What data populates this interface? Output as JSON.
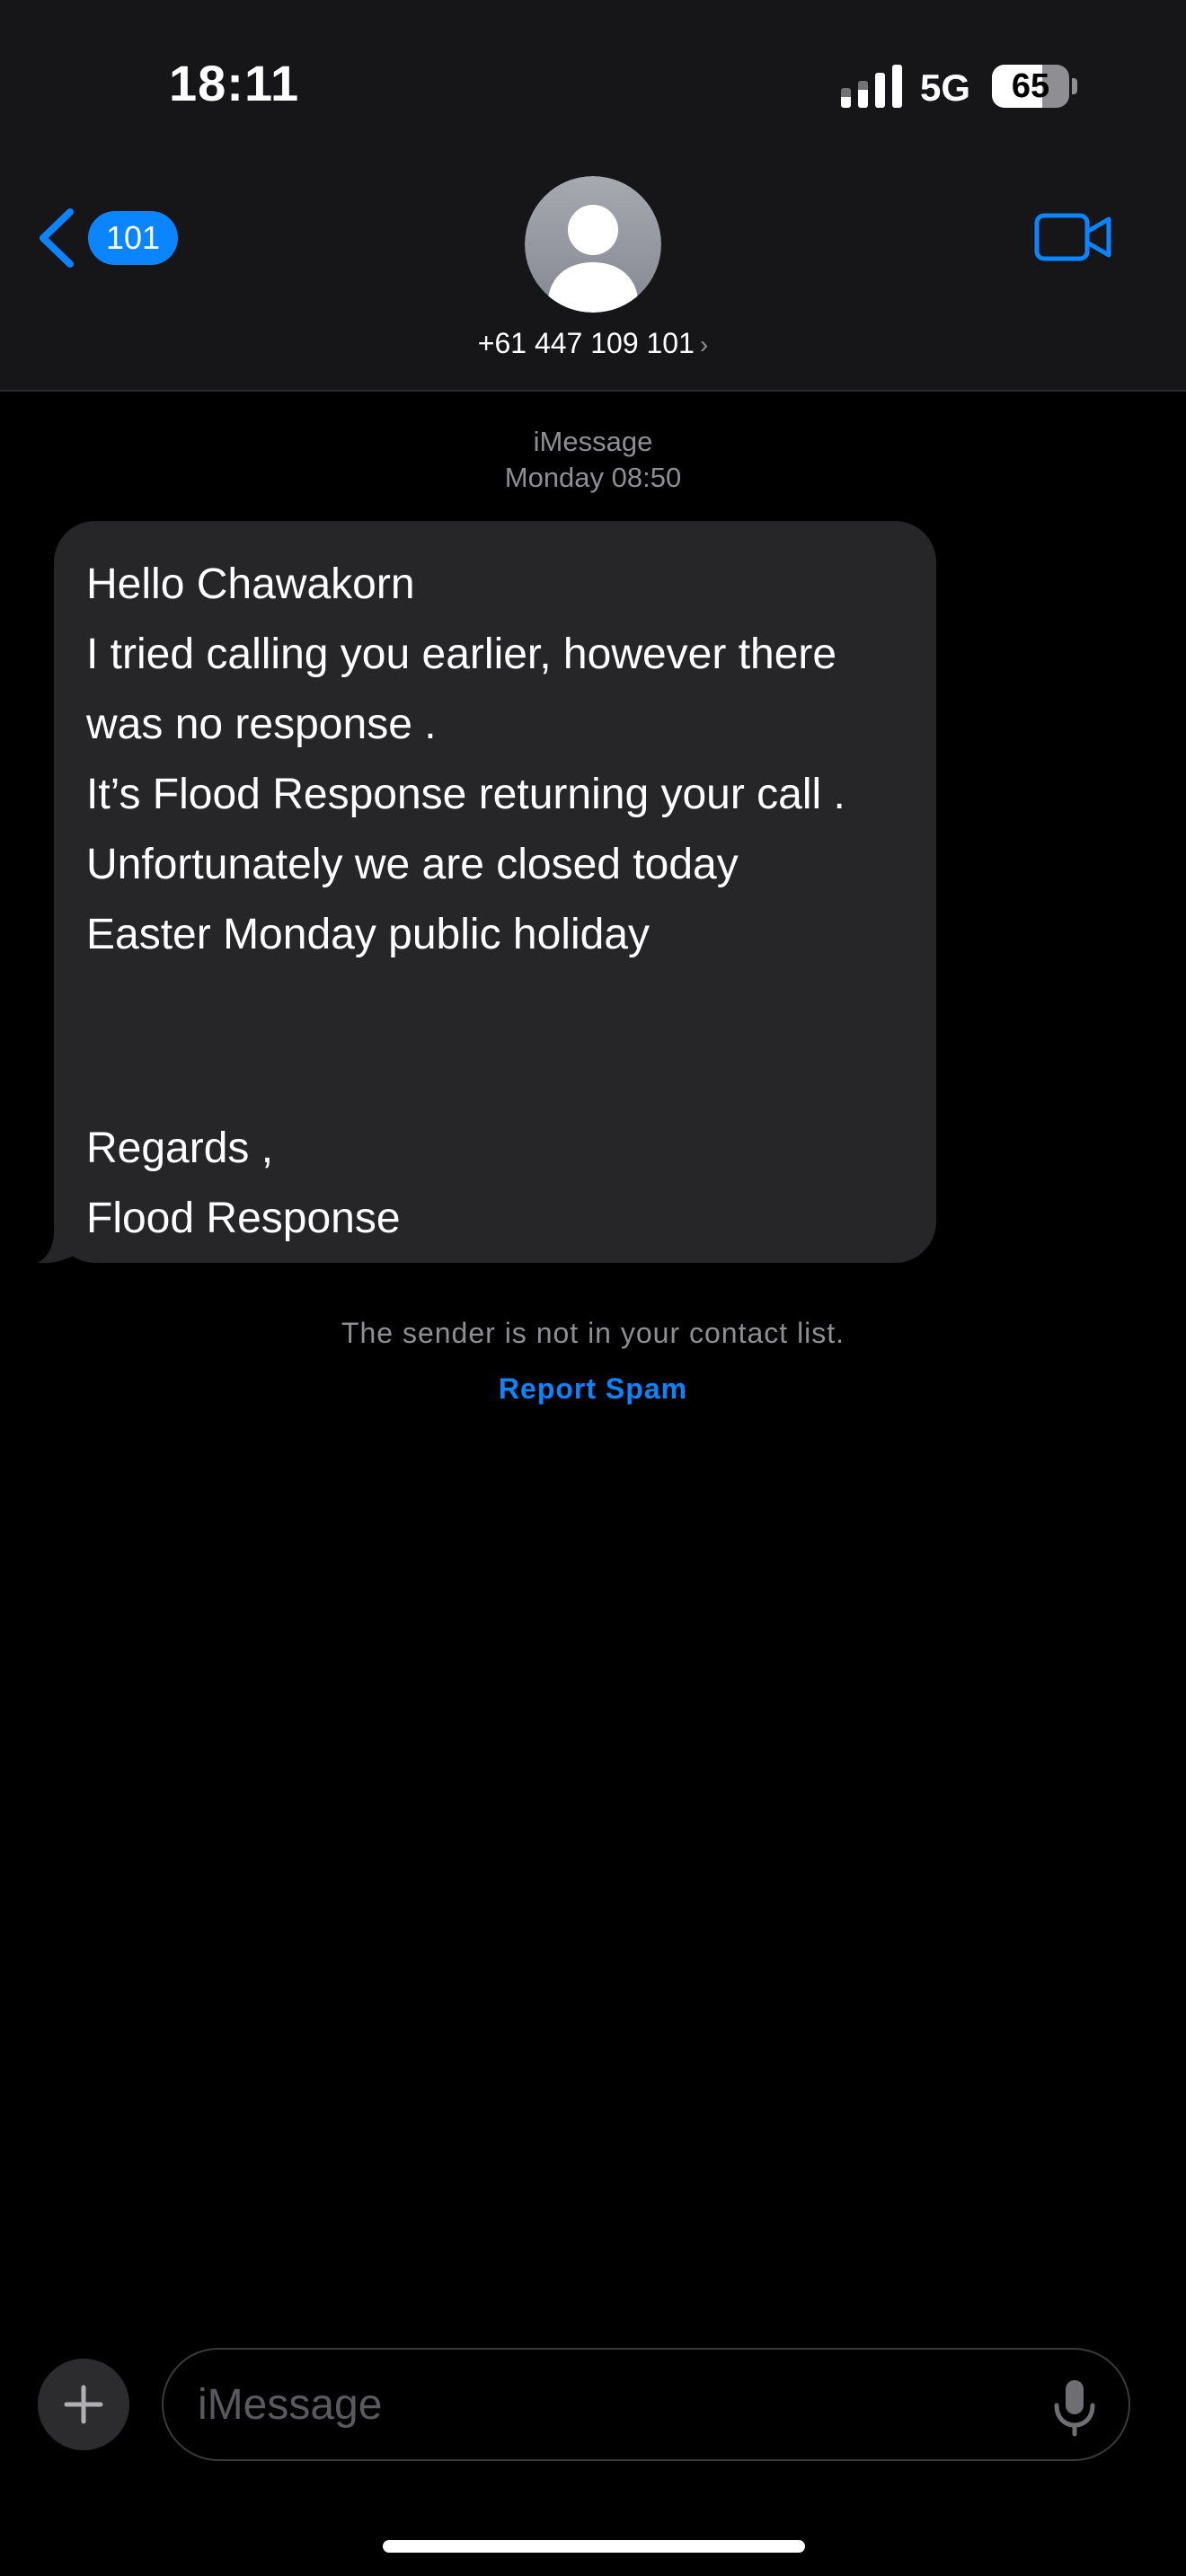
{
  "status_bar": {
    "time": "18:11",
    "network": "5G",
    "battery_level": "65",
    "battery_fraction": 0.65
  },
  "header": {
    "back_badge": "101",
    "contact": "+61 447 109 101",
    "contact_chevron": "›",
    "icons": {
      "back": "chevron-left-icon",
      "avatar": "person-silhouette-icon",
      "video": "video-camera-icon"
    }
  },
  "conversation": {
    "service": "iMessage",
    "timestamp": "Monday 08:50",
    "message": {
      "lines": [
        "Hello Chawakorn",
        "I tried calling you earlier, however there",
        "was no response .",
        "It’s Flood Response returning your call .",
        "Unfortunately we are closed today",
        "Easter Monday public holiday",
        "",
        "",
        "Regards ,",
        "Flood Response"
      ]
    },
    "sender_note": "The sender is not in your contact list.",
    "report_spam": "Report Spam"
  },
  "composer": {
    "placeholder": "iMessage",
    "icons": {
      "plus": "plus-icon",
      "mic": "microphone-icon"
    }
  },
  "colors": {
    "accent": "#0a84ff",
    "header_bg": "#161618",
    "bubble_bg": "#262629",
    "secondary_text": "#8e8e93"
  }
}
